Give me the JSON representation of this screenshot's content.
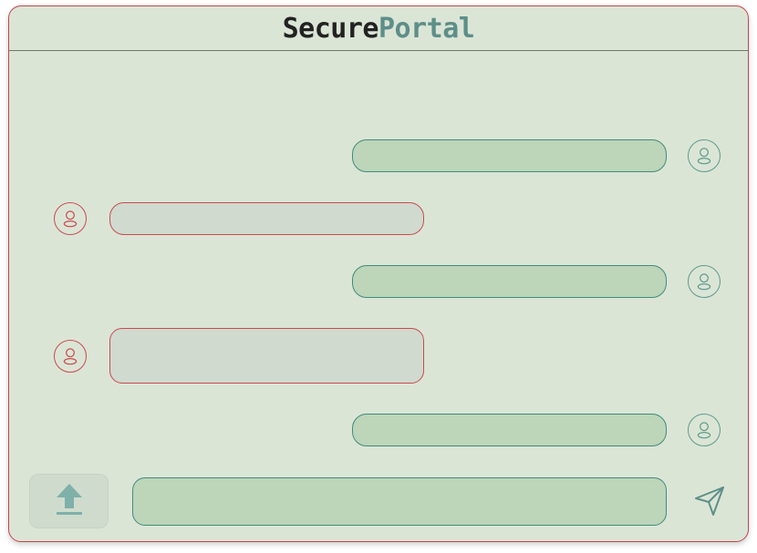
{
  "app": {
    "title_part1": "Secure",
    "title_part2": "Portal"
  },
  "messages": [
    {
      "direction": "outgoing",
      "text": ""
    },
    {
      "direction": "incoming",
      "text": ""
    },
    {
      "direction": "outgoing",
      "text": ""
    },
    {
      "direction": "incoming",
      "text": ""
    },
    {
      "direction": "outgoing",
      "text": ""
    }
  ],
  "composer": {
    "value": "",
    "placeholder": ""
  },
  "icons": {
    "upload": "upload-icon",
    "send": "send-icon",
    "avatar": "user-avatar-icon"
  },
  "colors": {
    "background": "#dbe5d6",
    "border_accent": "#c6454b",
    "outgoing_bubble": "#bdd5b9",
    "outgoing_border": "#3f8c7d",
    "incoming_bubble": "#d0dacf",
    "incoming_border": "#c94b4e",
    "title_primary": "#222222",
    "title_accent": "#5d8e89"
  }
}
